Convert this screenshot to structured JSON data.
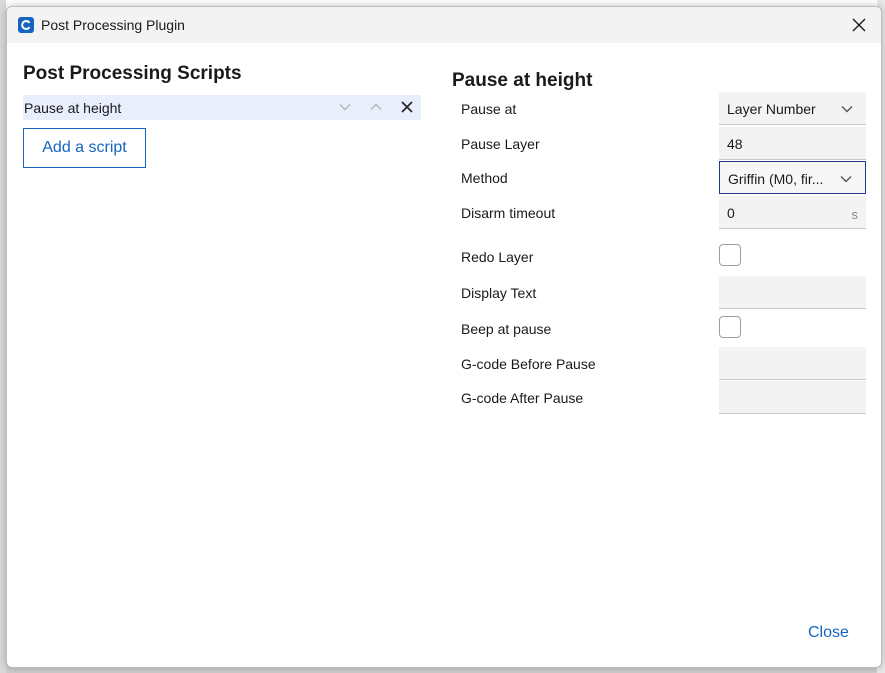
{
  "window": {
    "title": "Post Processing Plugin"
  },
  "scripts_panel": {
    "heading": "Post Processing Scripts",
    "items": [
      {
        "name": "Pause at height"
      }
    ],
    "add_button_label": "Add a script"
  },
  "settings_panel": {
    "heading": "Pause at height",
    "rows": [
      {
        "label": "Pause at",
        "value": "Layer Number"
      },
      {
        "label": "Pause Layer",
        "value": "48"
      },
      {
        "label": "Method",
        "value": "Griffin (M0, fir..."
      },
      {
        "label": "Disarm timeout",
        "value": "0",
        "unit": "s"
      },
      {
        "label": "Redo Layer"
      },
      {
        "label": "Display Text",
        "value": ""
      },
      {
        "label": "Beep at pause"
      },
      {
        "label": "G-code Before Pause",
        "value": ""
      },
      {
        "label": "G-code After Pause",
        "value": ""
      }
    ]
  },
  "footer": {
    "close_label": "Close"
  },
  "colors": {
    "accent": "#1565c0",
    "selected_row": "#e8eefb",
    "field_bg": "#f3f3f3",
    "focus_border": "#1e3a8a"
  },
  "icons": {
    "app": "cura-app-icon",
    "close": "close-icon",
    "move_down": "chevron-down-icon",
    "move_up": "chevron-up-icon",
    "remove": "close-icon",
    "dropdown": "chevron-down-icon"
  }
}
